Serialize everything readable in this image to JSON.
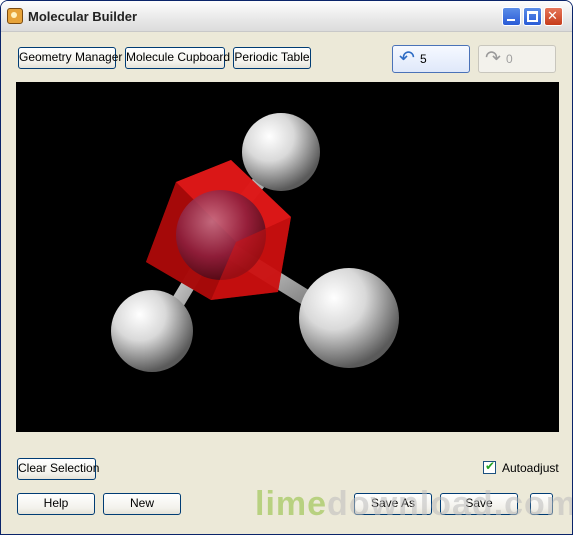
{
  "window": {
    "title": "Molecular Builder"
  },
  "toolbar": {
    "geometry_manager": "Geometry Manager",
    "molecule_cupboard": "Molecule Cupboard",
    "periodic_table": "Periodic Table",
    "undo_count": "5",
    "redo_count": "0"
  },
  "viewport": {
    "background": "#000000",
    "molecule": {
      "center_atom": {
        "element": "O",
        "color": "#cc0a0a",
        "selected": true
      },
      "atoms": [
        {
          "element": "H",
          "color": "#e8e8e8"
        },
        {
          "element": "H",
          "color": "#e8e8e8"
        },
        {
          "element": "H",
          "color": "#e8e8e8"
        }
      ]
    }
  },
  "controls": {
    "clear_selection": "Clear Selection",
    "autoadjust_label": "Autoadjust",
    "autoadjust_checked": true
  },
  "footer": {
    "help": "Help",
    "new": "New",
    "save_as": "Save As",
    "save": "Save"
  },
  "watermark": {
    "part1": "lime",
    "part2": "download.com"
  }
}
